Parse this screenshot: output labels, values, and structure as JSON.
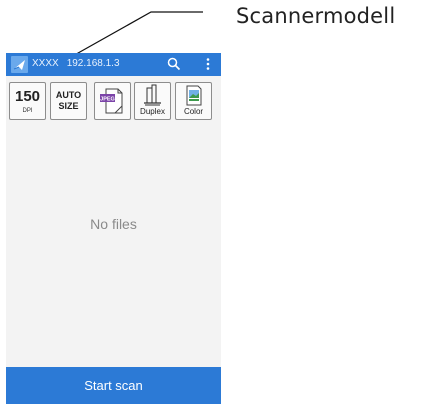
{
  "callout": {
    "label": "Scannermodell"
  },
  "appbar": {
    "device_name": "XXXX",
    "device_ip": "192.168.1.3",
    "icons": [
      "app-logo-icon",
      "search-icon",
      "overflow-menu-icon"
    ],
    "color": "#2c7ad6"
  },
  "toolbar": {
    "resolution": {
      "value": "150",
      "unit": "DPI"
    },
    "paper_size": {
      "line1": "AUTO",
      "line2": "SIZE"
    },
    "file_format": {
      "label": "JPEG",
      "icon": "jpeg-file-icon"
    },
    "duplex": {
      "label": "Duplex",
      "icon": "duplex-icon"
    },
    "color_mode": {
      "label": "Color",
      "icon": "color-mode-icon"
    }
  },
  "content": {
    "empty_text": "No files"
  },
  "footer": {
    "start_label": "Start scan"
  }
}
